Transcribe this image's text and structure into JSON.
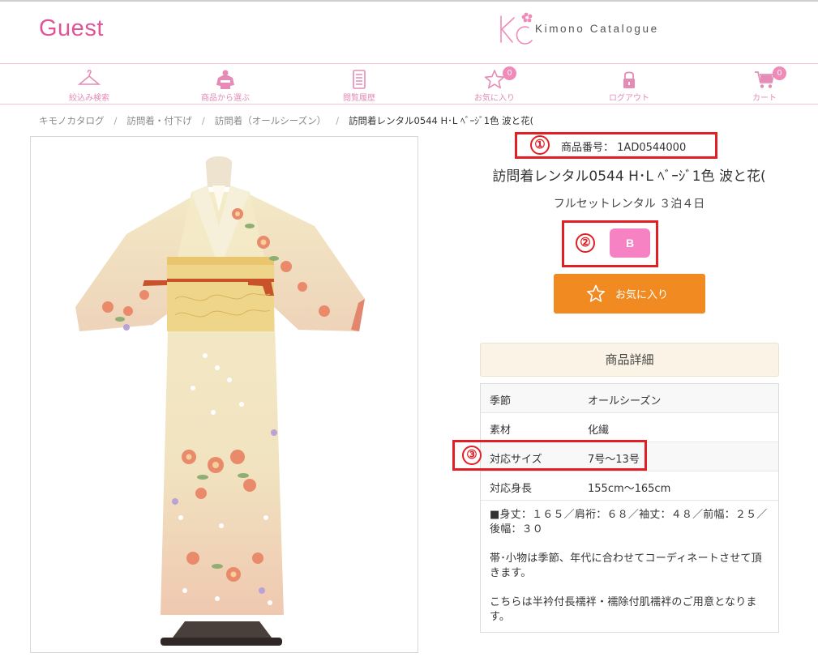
{
  "header": {
    "guest_label": "Guest",
    "logo_text": "Kimono Catalogue",
    "accent_color": "#e0559a"
  },
  "nav": {
    "items": [
      {
        "label": "絞込み検索",
        "icon": "hanger-icon"
      },
      {
        "label": "商品から選ぶ",
        "icon": "kimono-icon"
      },
      {
        "label": "閲覧履歴",
        "icon": "history-icon"
      },
      {
        "label": "お気に入り",
        "icon": "star-icon",
        "badge": "0"
      },
      {
        "label": "ログアウト",
        "icon": "lock-icon"
      },
      {
        "label": "カート",
        "icon": "cart-icon",
        "badge": "0"
      }
    ]
  },
  "breadcrumb": {
    "items": [
      "キモノカタログ",
      "訪問着・付下げ",
      "訪問着（オールシーズン）"
    ],
    "current": "訪問着レンタル0544 H･L ﾍﾞｰｼﾞ1色 波と花(",
    "separator": "/"
  },
  "product": {
    "number_label": "商品番号：",
    "number": "1AD0544000",
    "title": "訪問着レンタル0544 H･L ﾍﾞｰｼﾞ1色 波と花(",
    "plan": "フルセットレンタル ３泊４日",
    "size_badge": "B",
    "favorite_button": "お気に入り"
  },
  "callouts": [
    "①",
    "②",
    "③"
  ],
  "details": {
    "heading": "商品詳細",
    "rows": [
      {
        "key": "季節",
        "value": "オールシーズン"
      },
      {
        "key": "素材",
        "value": "化繊"
      },
      {
        "key": "対応サイズ",
        "value": "7号～13号"
      },
      {
        "key": "対応身長",
        "value": "155cm～165cm"
      }
    ],
    "notes": [
      "■身丈：１６５／肩裄：６８／袖丈：４８／前幅：２５／後幅：３０",
      "帯･小物は季節、年代に合わせてコーディネートさせて頂きます。",
      "こちらは半衿付長襦袢・襦除付肌襦袢のご用意となります。"
    ]
  }
}
